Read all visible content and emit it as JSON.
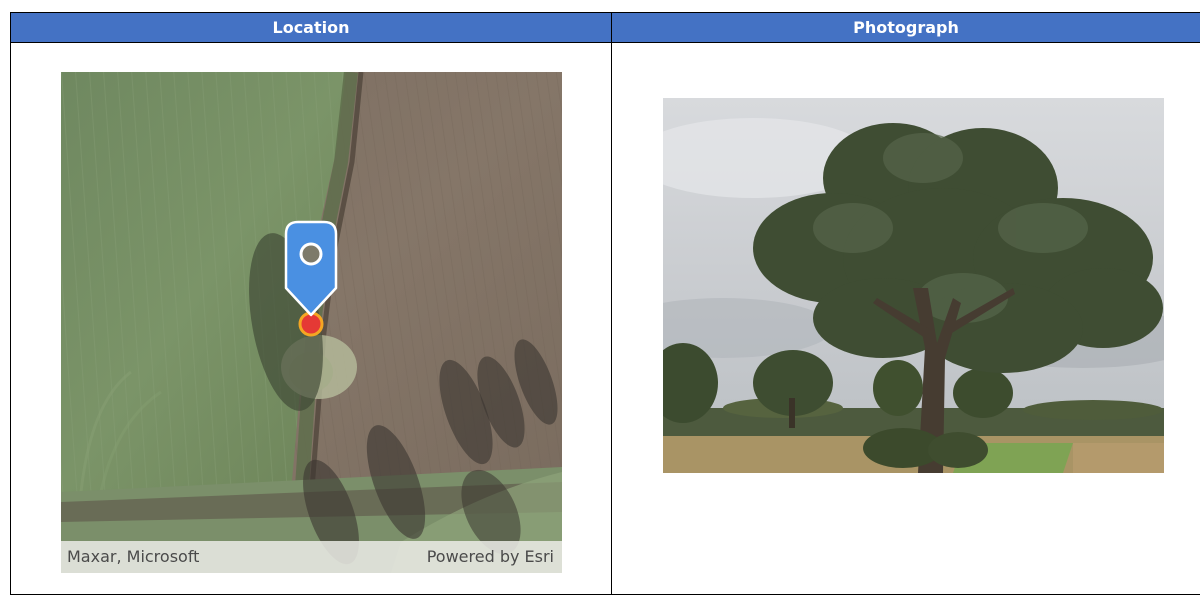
{
  "table": {
    "headers": [
      "Location",
      "Photograph"
    ]
  },
  "map": {
    "attribution_left": "Maxar, Microsoft",
    "attribution_right": "Powered by Esri",
    "marker_color": "#4a90e2",
    "point_color": "#e53935",
    "point_ring_color": "#f5a623"
  },
  "colors": {
    "header_bg": "#4472c4",
    "header_text": "#ffffff",
    "border": "#000000"
  }
}
